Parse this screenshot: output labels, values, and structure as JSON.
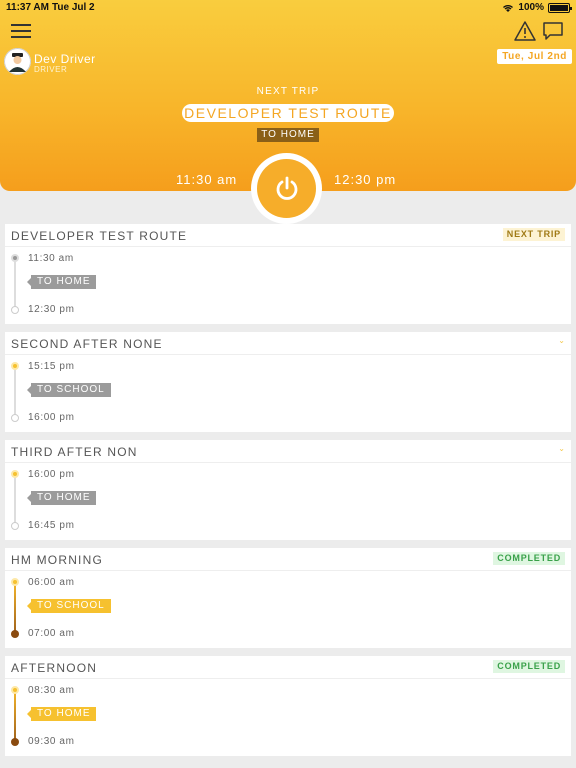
{
  "status_bar": {
    "time": "11:37 AM",
    "date": "Tue Jul 2",
    "battery": "100%"
  },
  "header": {
    "driver_name": "Dev Driver",
    "driver_role": "DRIVER",
    "date_badge": "Tue, Jul 2nd",
    "next_trip_label": "NEXT TRIP",
    "route_name": "DEVELOPER TEST ROUTE",
    "direction": "TO HOME",
    "start_time": "11:30 am",
    "end_time": "12:30 pm"
  },
  "colors": {
    "accent": "#f6ad2a",
    "header_top": "#f9cd3e",
    "header_bottom": "#f59e1c",
    "completed": "#3aa14a"
  },
  "trips": [
    {
      "title": "DEVELOPER TEST ROUTE",
      "status": "NEXT TRIP",
      "start": "11:30 am",
      "direction": "TO HOME",
      "end": "12:30 pm"
    },
    {
      "title": "SECOND AFTER NONE",
      "status": "",
      "start": "15:15 pm",
      "direction": "TO SCHOOL",
      "end": "16:00 pm"
    },
    {
      "title": "THIRD AFTER NON",
      "status": "",
      "start": "16:00 pm",
      "direction": "TO HOME",
      "end": "16:45 pm"
    },
    {
      "title": "HM MORNING",
      "status": "COMPLETED",
      "start": "06:00 am",
      "direction": "TO SCHOOL",
      "end": "07:00 am"
    },
    {
      "title": "AFTERNOON",
      "status": "COMPLETED",
      "start": "08:30 am",
      "direction": "TO HOME",
      "end": "09:30 am"
    }
  ]
}
